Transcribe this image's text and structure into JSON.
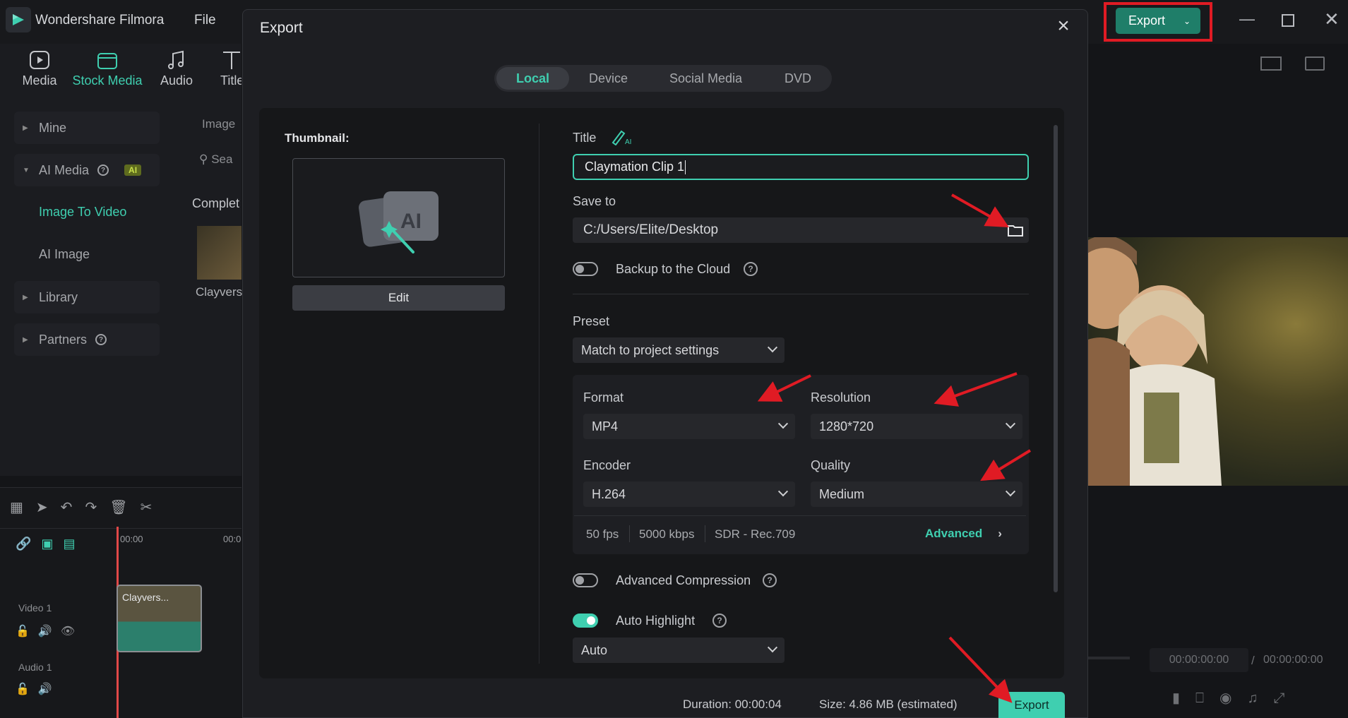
{
  "app": {
    "name": "Wondershare Filmora",
    "menu": [
      "File"
    ],
    "export_label": "Export",
    "top_tabs": [
      "Media",
      "Stock Media",
      "Audio",
      "Title"
    ],
    "sidebar": [
      {
        "label": "Mine"
      },
      {
        "label": "AI Media",
        "badge": "AI"
      },
      {
        "label": "Image To Video"
      },
      {
        "label": "AI Image"
      },
      {
        "label": "Library"
      },
      {
        "label": "Partners"
      }
    ],
    "partial_labels": {
      "image": "Image",
      "search": "Sea",
      "complete": "Complet",
      "clip": "Clayvers"
    },
    "timeline": {
      "time_start": "00:00",
      "time_next": "00:0",
      "video_track": "Video 1",
      "audio_track": "Audio 1",
      "clip_label": "Clayvers..."
    },
    "preview": {
      "time_current": "00:00:00:00",
      "time_sep": "/",
      "time_total": "00:00:00:00"
    }
  },
  "dialog": {
    "title": "Export",
    "tabs": [
      "Local",
      "Device",
      "Social Media",
      "DVD"
    ],
    "active_tab": "Local",
    "thumbnail_label": "Thumbnail:",
    "edit_label": "Edit",
    "title_label": "Title",
    "title_value": "Claymation Clip 1",
    "save_to_label": "Save to",
    "save_to_value": "C:/Users/Elite/Desktop",
    "backup_label": "Backup to the Cloud",
    "preset_label": "Preset",
    "preset_value": "Match to project settings",
    "format_label": "Format",
    "format_value": "MP4",
    "resolution_label": "Resolution",
    "resolution_value": "1280*720",
    "encoder_label": "Encoder",
    "encoder_value": "H.264",
    "quality_label": "Quality",
    "quality_value": "Medium",
    "specs": [
      "50 fps",
      "5000 kbps",
      "SDR - Rec.709"
    ],
    "advanced_label": "Advanced",
    "adv_compression_label": "Advanced Compression",
    "auto_highlight_label": "Auto Highlight",
    "auto_highlight_value": "Auto",
    "duration": "Duration: 00:00:04",
    "size": "Size:  4.86 MB (estimated)",
    "export_button": "Export"
  },
  "colors": {
    "accent": "#3fcfb0",
    "annotation_red": "#e01b24",
    "export_green": "#1f7e69"
  }
}
